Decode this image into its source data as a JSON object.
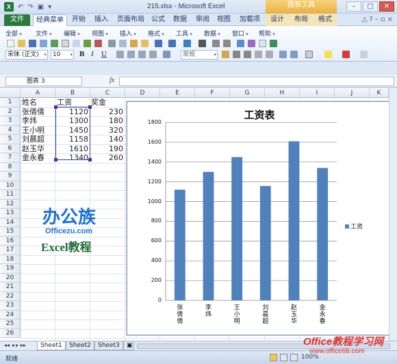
{
  "window": {
    "title": "215.xlsx - Microsoft Excel",
    "contextual_group": "图表工具",
    "controls": [
      "–",
      "□",
      "✕"
    ]
  },
  "tabs": [
    "文件",
    "经典菜单",
    "开始",
    "插入",
    "页面布局",
    "公式",
    "数据",
    "审阅",
    "视图",
    "加载项",
    "设计",
    "布局",
    "格式"
  ],
  "menus": [
    "全部",
    "文件",
    "编辑",
    "视图",
    "插入",
    "格式",
    "工具",
    "数据",
    "窗口",
    "帮助"
  ],
  "font": {
    "name": "宋体 (正文)",
    "size": "10",
    "bold": "B",
    "italic": "I",
    "underline": "U",
    "number_format": "常规"
  },
  "formula_bar": {
    "name_box": "图表 3",
    "fx": "fx",
    "content": ""
  },
  "sheet": {
    "columns": [
      "A",
      "B",
      "C",
      "D",
      "E",
      "F",
      "G",
      "H",
      "I",
      "J",
      "K"
    ],
    "rows": [
      "1",
      "2",
      "3",
      "4",
      "5",
      "6",
      "7",
      "8",
      "9",
      "10",
      "11",
      "12",
      "13",
      "14",
      "15",
      "16",
      "17",
      "18",
      "19",
      "20",
      "21",
      "22",
      "23",
      "24",
      "25",
      "26"
    ],
    "headers": {
      "a": "姓名",
      "b": "工资",
      "c": "奖金"
    },
    "records": [
      {
        "name": "张倩倩",
        "salary": "1120",
        "bonus": "230"
      },
      {
        "name": "李炜",
        "salary": "1300",
        "bonus": "180"
      },
      {
        "name": "王小明",
        "salary": "1450",
        "bonus": "320"
      },
      {
        "name": "刘晨超",
        "salary": "1158",
        "bonus": "140"
      },
      {
        "name": "赵玉华",
        "salary": "1610",
        "bonus": "190"
      },
      {
        "name": "金永春",
        "salary": "1340",
        "bonus": "260"
      }
    ]
  },
  "chart_data": {
    "type": "bar",
    "title": "工资表",
    "categories": [
      "张倩倩",
      "李炜",
      "王小明",
      "刘晨超",
      "赵玉华",
      "金永春"
    ],
    "series": [
      {
        "name": "工资",
        "values": [
          1120,
          1300,
          1450,
          1158,
          1610,
          1340
        ],
        "color": "#4f81bd"
      }
    ],
    "ylim": [
      0,
      1800
    ],
    "yticks": [
      0,
      200,
      400,
      600,
      800,
      1000,
      1200,
      1400,
      1600,
      1800
    ],
    "xlabel": "",
    "ylabel": "",
    "grid": true,
    "legend": "right"
  },
  "watermarks": {
    "logo_cn": "办公族",
    "logo_url": "Officezu.com",
    "logo_sub": "Excel教程",
    "site_cn": "Office教程学习网",
    "site_url": "www.office68.com"
  },
  "sheet_tabs": [
    "Sheet1",
    "Sheet2",
    "Sheet3"
  ],
  "status": {
    "ready": "就绪",
    "zoom": "100%"
  }
}
